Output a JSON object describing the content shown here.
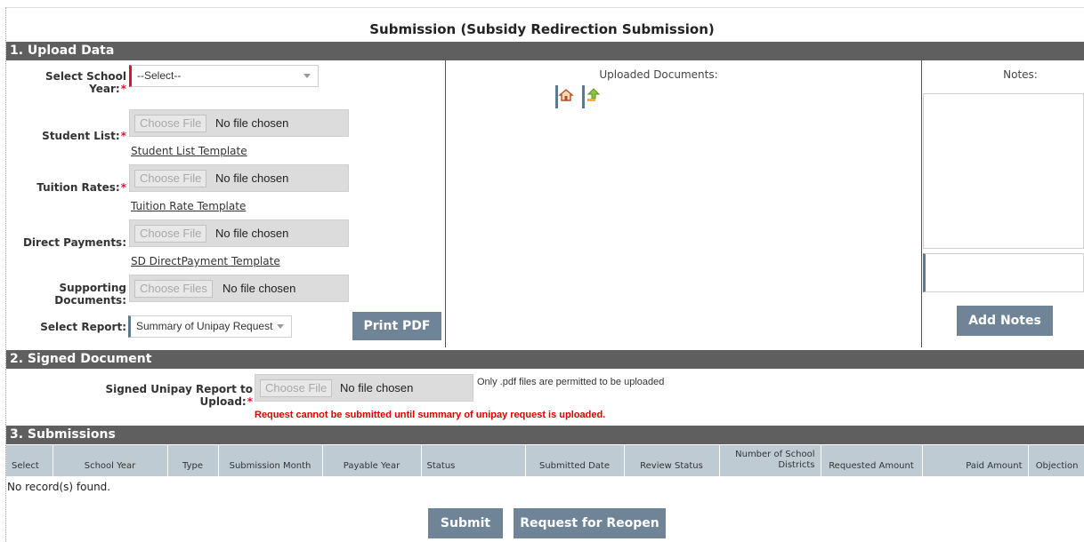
{
  "page_title": "Submission (Subsidy Redirection Submission)",
  "sections": {
    "upload_data": "1. Upload Data",
    "signed_document": "2. Signed Document",
    "submissions": "3. Submissions"
  },
  "upload": {
    "school_year_label": "Select School Year:",
    "school_year_value": "--Select--",
    "student_list_label": "Student List:",
    "tuition_rates_label": "Tuition Rates:",
    "direct_payments_label": "Direct Payments:",
    "supporting_docs_label": "Supporting Documents:",
    "choose_file": "Choose File",
    "choose_files": "Choose Files",
    "no_file": "No file chosen",
    "student_list_template": "Student List Template",
    "tuition_rate_template": "Tuition Rate Template",
    "direct_payment_template": "SD DirectPayment Template",
    "select_report_label": "Select Report:",
    "select_report_value": "Summary of Unipay Request",
    "print_pdf": "Print PDF",
    "required_mark": "*"
  },
  "uploaded_docs": {
    "heading": "Uploaded Documents:",
    "icons": [
      "home-icon",
      "upload-arrow-icon"
    ]
  },
  "notes": {
    "heading": "Notes:",
    "add_notes": "Add Notes"
  },
  "signed": {
    "label": "Signed Unipay Report to Upload:",
    "choose_file": "Choose File",
    "no_file": "No file chosen",
    "hint": "Only .pdf files are permitted to be uploaded",
    "error": "Request cannot be submitted until summary of unipay request is uploaded."
  },
  "table": {
    "headers": [
      "Select",
      "School Year",
      "Type",
      "Submission Month",
      "Payable Year",
      "Status",
      "Submitted Date",
      "Review Status",
      "Number of School Districts",
      "Requested Amount",
      "Paid Amount",
      "Objection"
    ],
    "empty": "No record(s) found."
  },
  "actions": {
    "submit": "Submit",
    "reopen": "Request for Reopen"
  },
  "colors": {
    "section_bar": "#5f5f5f",
    "button": "#6f8597",
    "table_header": "#bfcbd3",
    "required": "#d9123b",
    "error": "#dd0000"
  }
}
